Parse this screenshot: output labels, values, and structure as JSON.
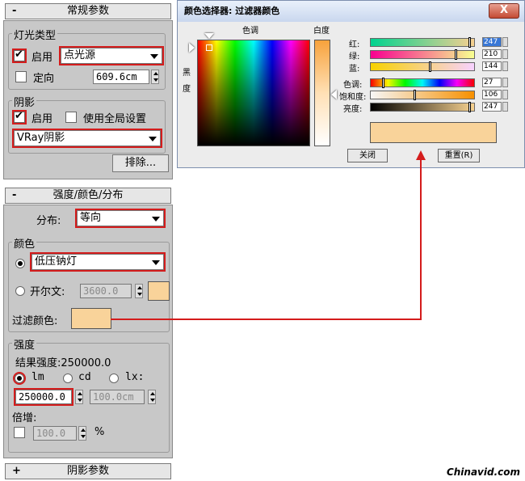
{
  "general_params": {
    "header": "常规参数",
    "sign": "-",
    "light_type_group": "灯光类型",
    "enable_label": "启用",
    "light_type_value": "点光源",
    "target_label": "定向",
    "target_distance": "609.6cm",
    "shadow_group": "阴影",
    "shadow_enable_label": "启用",
    "global_settings_label": "使用全局设置",
    "shadow_type_value": "VRay阴影",
    "exclude_button": "排除..."
  },
  "intensity_panel": {
    "header": "强度/颜色/分布",
    "sign": "-",
    "distribution_label": "分布:",
    "distribution_value": "等向",
    "color_group": "颜色",
    "lamp_value": "低压钠灯",
    "kelvin_label": "开尔文:",
    "kelvin_value": "3600.0",
    "filter_color_label": "过滤颜色:",
    "intensity_group": "强度",
    "result_intensity": "结果强度:250000.0",
    "unit_lm": "lm",
    "unit_cd": "cd",
    "unit_lx": "lx:",
    "intensity_value": "250000.0",
    "distance_value": "100.0cm",
    "multiplier_label": "倍增:",
    "multiplier_value": "100.0",
    "percent": "%"
  },
  "shadow_params": {
    "header": "阴影参数",
    "sign": "+"
  },
  "dialog": {
    "title": "颜色选择器: 过滤器颜色",
    "close_x": "X",
    "hue_label": "色调",
    "white_label": "白度",
    "black_label": "黑\n度",
    "rows": [
      {
        "label": "红:",
        "value": "247"
      },
      {
        "label": "绿:",
        "value": "210"
      },
      {
        "label": "蓝:",
        "value": "144"
      },
      {
        "label": "色调:",
        "value": "27"
      },
      {
        "label": "饱和度:",
        "value": "106"
      },
      {
        "label": "亮度:",
        "value": "247"
      }
    ],
    "close_button": "关闭",
    "reset_button": "重置(R)"
  },
  "colors": {
    "filter_color": "#f9d39a",
    "highlight": "#d41c1c"
  },
  "watermark": "Chinavid.com"
}
